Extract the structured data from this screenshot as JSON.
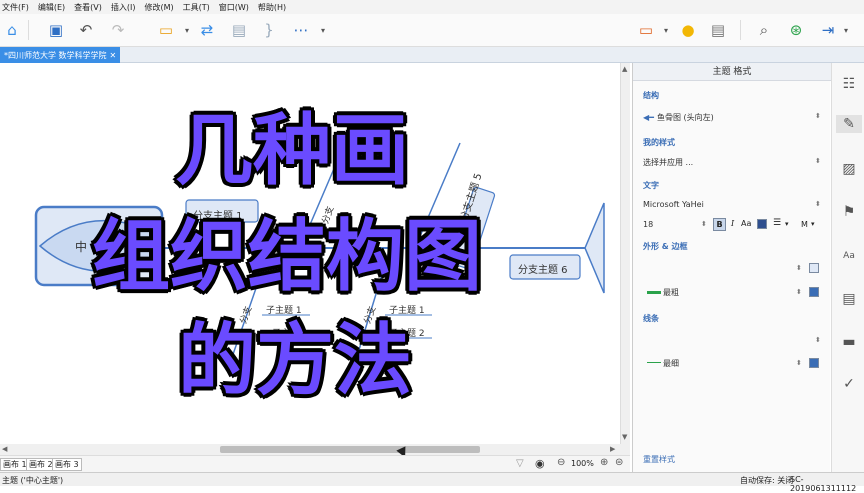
{
  "menu": [
    "文件(F)",
    "编辑(E)",
    "查看(V)",
    "插入(I)",
    "修改(M)",
    "工具(T)",
    "窗口(W)",
    "帮助(H)"
  ],
  "tab": {
    "label": "*四川师范大学 数学科学学院",
    "close": "✕"
  },
  "canvas": {
    "topics": [
      "分支主题 1",
      "分支主题 5",
      "分支主题 6",
      "子主题 1",
      "子主题 1",
      "子主题 2",
      "子主题"
    ],
    "central_partial": "中",
    "rot_labels": [
      "分支",
      "分支",
      "分支"
    ]
  },
  "overlay": {
    "line1": "几种画",
    "line2": "组织结构图",
    "line3": "的方法"
  },
  "sheets": [
    "画布 1",
    "画布 2",
    "画布 3"
  ],
  "zoom": "100%",
  "status": {
    "left": "主题 ('中心主题')",
    "autosave": "自动保存: 关闭",
    "version": "SC-2019061311112"
  },
  "panel": {
    "title": "主题 格式",
    "structure_label": "结构",
    "structure_value": "鱼骨图 (头向左)",
    "mystyle_label": "我的样式",
    "mystyle_value": "选择并应用 ...",
    "text_label": "文字",
    "font_name": "Microsoft YaHei",
    "font_size": "18",
    "bold": "B",
    "italic": "I",
    "shape_label": "外形 & 边框",
    "border_weight": "最粗",
    "line_label": "线条",
    "line_weight": "最细",
    "reset_label": "重置样式"
  },
  "colors": {
    "accent": "#3a8ee6",
    "overlay_text": "#6a4bff",
    "topic_border": "#4a7cc7",
    "topic_fill": "#dfe8f6"
  }
}
